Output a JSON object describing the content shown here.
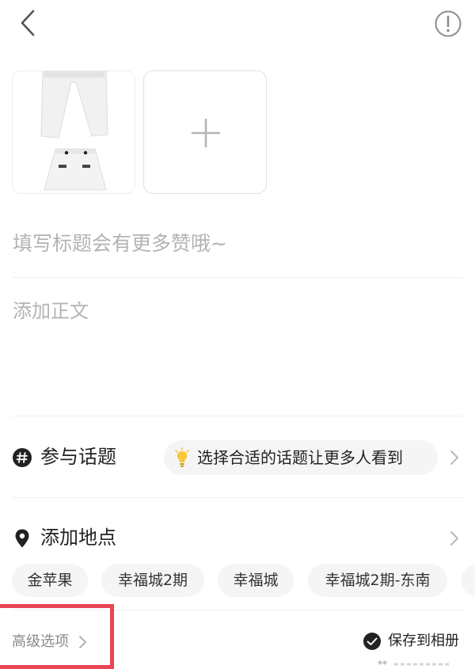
{
  "header": {
    "back_icon": "chevron-left-icon",
    "info_icon": "exclamation-circle-icon"
  },
  "media": {
    "thumbnail_icon": "clothing-photo-icon",
    "add_icon": "plus-icon"
  },
  "editor": {
    "title_placeholder": "填写标题会有更多赞哦~",
    "body_placeholder": "添加正文"
  },
  "topic": {
    "icon": "hashtag-icon",
    "label": "参与话题",
    "hint": "选择合适的话题让更多人看到",
    "hint_icon": "lightbulb-icon"
  },
  "location": {
    "icon": "map-pin-icon",
    "label": "添加地点",
    "chips": [
      "金苹果",
      "幸福城2期",
      "幸福城",
      "幸福城2期-东南"
    ]
  },
  "footer": {
    "advanced_label": "高级选项",
    "save_label": "保存到相册",
    "save_checked": true
  },
  "colors": {
    "highlight_border": "#ea4553",
    "placeholder": "#b3b3b3",
    "chip_bg": "#f5f5f5",
    "bulb": "#f6c83a"
  }
}
